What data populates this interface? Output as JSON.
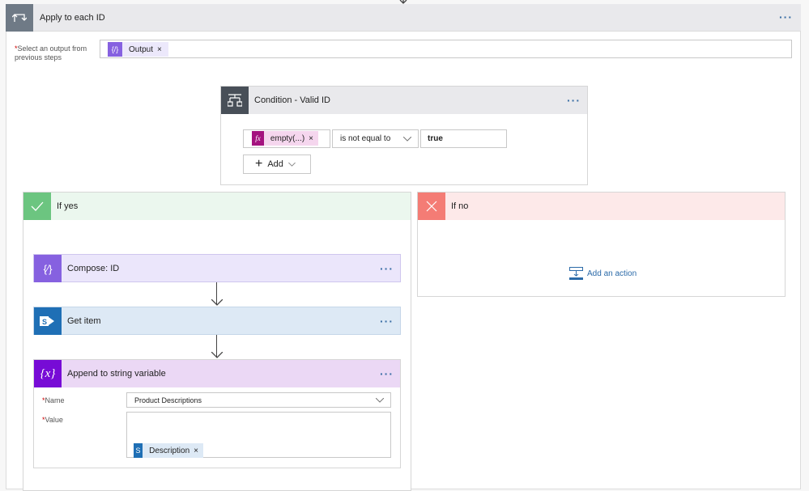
{
  "apply_each": {
    "title": "Apply to each ID",
    "more": "···",
    "select_label_req": "*",
    "select_label": "Select an output from previous steps",
    "token_label": "Output",
    "token_icon": "{/}",
    "remove": "×"
  },
  "condition": {
    "title": "Condition - Valid ID",
    "more": "···",
    "left_token": "empty(...)",
    "left_icon": "fx",
    "remove": "×",
    "operator": "is not equal to",
    "right_value": "true",
    "add_label": "Add"
  },
  "if_yes": {
    "title": "If yes",
    "actions": [
      {
        "title": "Compose: ID",
        "more": "···"
      },
      {
        "title": "Get item",
        "more": "···"
      },
      {
        "title": "Append to string variable",
        "more": "···"
      }
    ],
    "append": {
      "name_label": "Name",
      "name_value": "Product Descriptions",
      "value_label": "Value",
      "value_token": "Description",
      "remove": "×",
      "req": "*"
    }
  },
  "if_no": {
    "title": "If no",
    "add_action": "Add an action"
  },
  "colors": {
    "apply_icon": "#6f7a86",
    "condition_icon": "#484f58",
    "yes": "#6cc580",
    "no": "#f47c75",
    "compose": "#8661e0",
    "sharepoint": "#1f6fb5",
    "variable": "#770bd6"
  }
}
